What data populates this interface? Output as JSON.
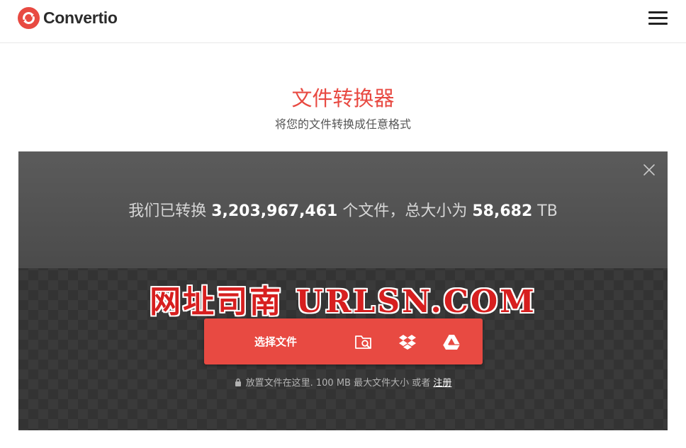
{
  "header": {
    "brand": "Convertio",
    "menu_icon": "hamburger-menu-icon"
  },
  "hero": {
    "title": "文件转换器",
    "subtitle": "将您的文件转换成任意格式"
  },
  "stats": {
    "prefix": "我们已转换",
    "file_count": "3,203,967,461",
    "middle": "个文件，总大小为",
    "total_size": "58,682",
    "unit": "TB"
  },
  "watermark": "网址司南 URLSN.COM",
  "upload": {
    "choose_label": "选择文件",
    "sources": [
      "folder-search-icon",
      "dropbox-icon",
      "google-drive-icon"
    ]
  },
  "drop_note": {
    "text": "放置文件在这里. 100 MB 最大文件大小 或者",
    "register_link": "注册"
  },
  "colors": {
    "accent": "#e84a42",
    "panel": "#3a3a3a",
    "panel_top": "#535353"
  }
}
